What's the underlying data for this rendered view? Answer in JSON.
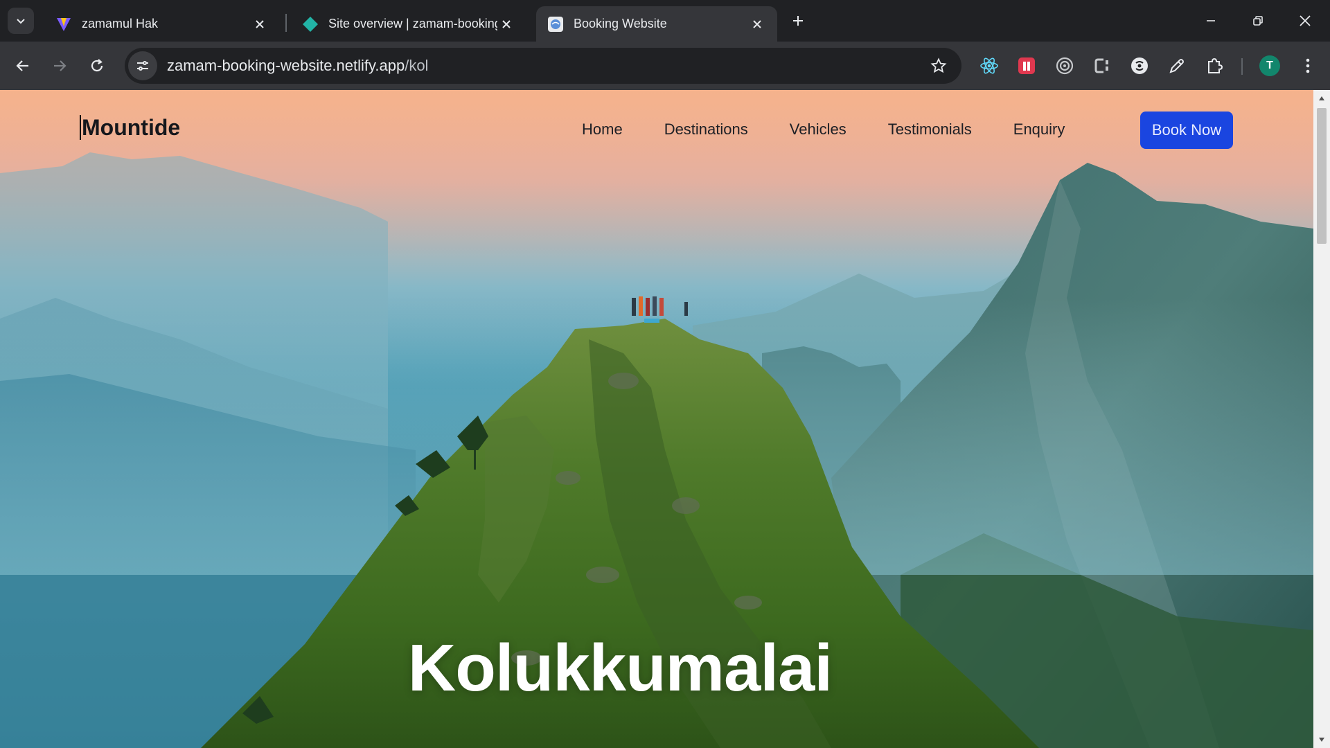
{
  "browser": {
    "tabs": [
      {
        "title": "zamamul Hak",
        "favicon": "vite-logo-icon",
        "active": false
      },
      {
        "title": "Site overview | zamam-booking",
        "favicon": "netlify-logo-icon",
        "active": false
      },
      {
        "title": "Booking Website",
        "favicon": "globe-favicon-icon",
        "active": true
      }
    ],
    "url_host": "zamam-booking-website.netlify.app",
    "url_path": "/kol",
    "profile_initial": "T",
    "extensions": [
      "react-devtools-icon",
      "extension-red-icon",
      "target-icon",
      "css-extension-icon",
      "extension-circle-icon",
      "color-picker-icon",
      "puzzle-icon"
    ]
  },
  "site": {
    "logo": "Mountide",
    "nav": {
      "home": "Home",
      "destinations": "Destinations",
      "vehicles": "Vehicles",
      "testimonials": "Testimonials",
      "enquiry": "Enquiry"
    },
    "cta": "Book Now",
    "hero_title": "Kolukkumalai"
  },
  "colors": {
    "cta_background": "#1a45e0",
    "chrome_dark": "#202124",
    "chrome_toolbar": "#35363a"
  }
}
